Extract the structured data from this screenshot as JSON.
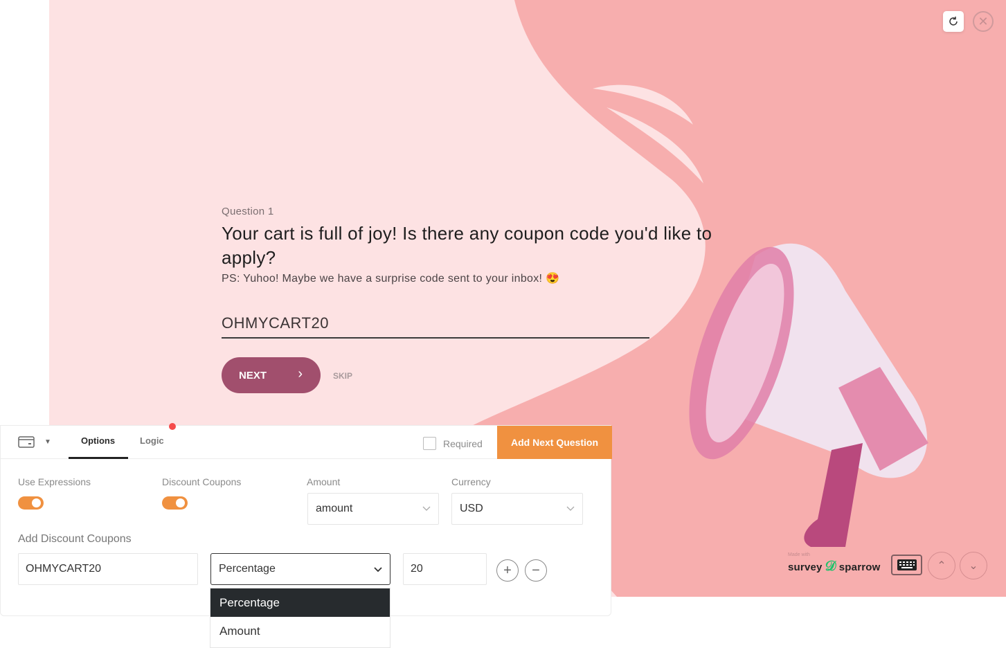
{
  "preview": {
    "question_number": "Question 1",
    "question_title": "Your cart is full of joy! Is there any coupon code you'd like to apply?",
    "question_description": "PS: Yuhoo! Maybe we have a surprise code sent to your inbox! 😍",
    "answer_value": "OHMYCART20",
    "next_label": "NEXT",
    "skip_label": "SKIP",
    "made_with": "Made with",
    "brand_left": "survey",
    "brand_right": "sparrow",
    "colors": {
      "background": "#fde2e3",
      "accent_shape": "#f7aeae",
      "button": "#a14f6d"
    },
    "icons": [
      "refresh-icon",
      "close-icon",
      "keyboard-icon",
      "chevron-up-icon",
      "chevron-down-icon"
    ]
  },
  "panel": {
    "tabs": [
      {
        "label": "Options",
        "active": true
      },
      {
        "label": "Logic",
        "active": false
      }
    ],
    "required_label": "Required",
    "required_checked": false,
    "add_next_label": "Add Next Question",
    "fields": {
      "use_expressions": {
        "label": "Use Expressions",
        "on": true
      },
      "discount_coupons": {
        "label": "Discount Coupons",
        "on": true
      },
      "amount": {
        "label": "Amount",
        "value": "amount"
      },
      "currency": {
        "label": "Currency",
        "value": "USD"
      }
    },
    "coupons_label": "Add Discount Coupons",
    "coupon": {
      "code": "OHMYCART20",
      "type": "Percentage",
      "value": "20"
    },
    "type_options": [
      {
        "label": "Percentage",
        "selected": true
      },
      {
        "label": "Amount",
        "selected": false
      }
    ],
    "colors": {
      "accent": "#f09140"
    }
  }
}
